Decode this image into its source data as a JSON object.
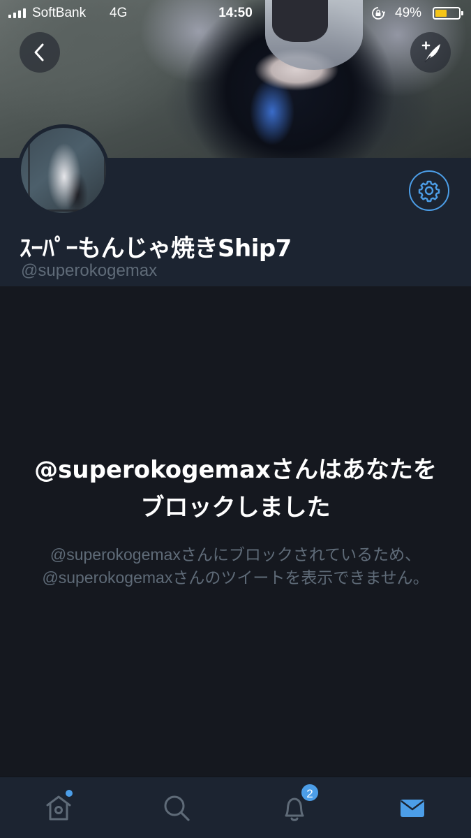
{
  "status_bar": {
    "carrier": "SoftBank",
    "network": "4G",
    "time": "14:50",
    "battery_percent": "49%",
    "battery_level": 0.49,
    "battery_color": "#f5c518"
  },
  "profile": {
    "display_name": "ｽｰﾊﾟｰもんじゃ焼きShip7",
    "handle": "@superokogemax"
  },
  "blocked_notice": {
    "title": "@superokogemaxさんはあなたをブロックしました",
    "description": "@superokogemaxさんにブロックされているため、@superokogemaxさんのツイートを表示できません。"
  },
  "tab_bar": {
    "items": [
      {
        "name": "home",
        "icon": "home-icon",
        "has_dot": true
      },
      {
        "name": "search",
        "icon": "search-icon"
      },
      {
        "name": "notifications",
        "icon": "bell-icon",
        "badge": "2"
      },
      {
        "name": "messages",
        "icon": "envelope-icon",
        "active": true
      }
    ]
  },
  "colors": {
    "accent": "#4c9ee8",
    "background": "#15181f",
    "header_bg": "#1c2431",
    "secondary_text": "#5f6b78"
  }
}
